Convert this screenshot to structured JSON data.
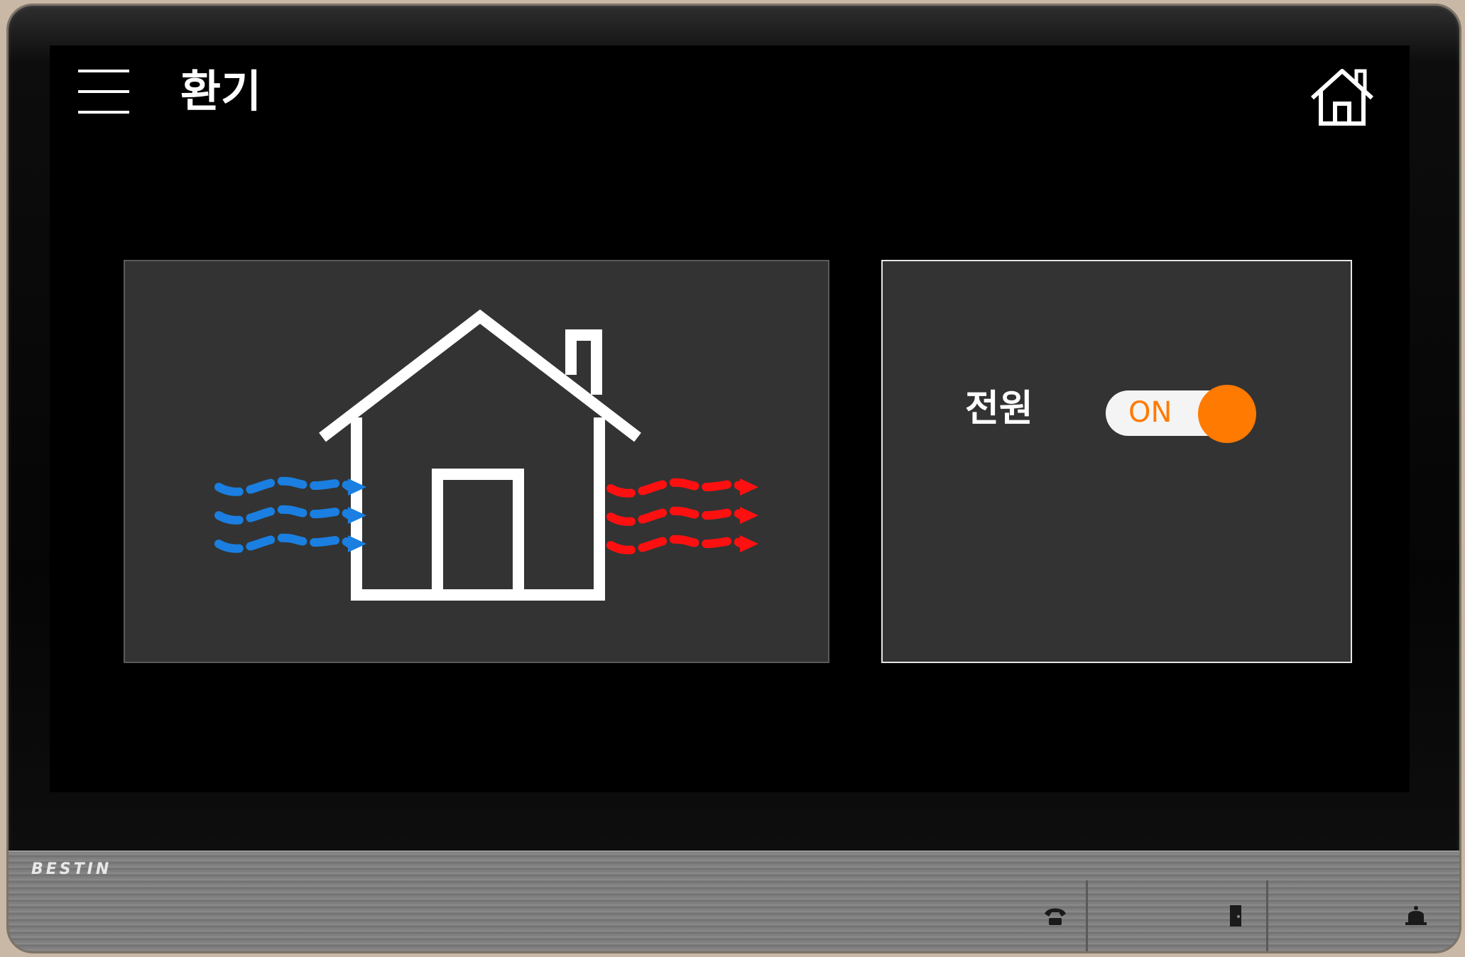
{
  "header": {
    "title": "환기",
    "menu_icon": "hamburger-menu-icon",
    "home_icon": "home-icon"
  },
  "illustration": {
    "icon": "ventilation-house-icon",
    "intake_color": "#1a7fe0",
    "exhaust_color": "#ff1010"
  },
  "power": {
    "label": "전원",
    "toggle_text": "ON",
    "state": "on",
    "accent_color": "#ff7a00"
  },
  "device": {
    "brand": "BESTIN",
    "hardware_buttons": [
      "phone-icon",
      "door-icon",
      "bell-icon"
    ]
  }
}
